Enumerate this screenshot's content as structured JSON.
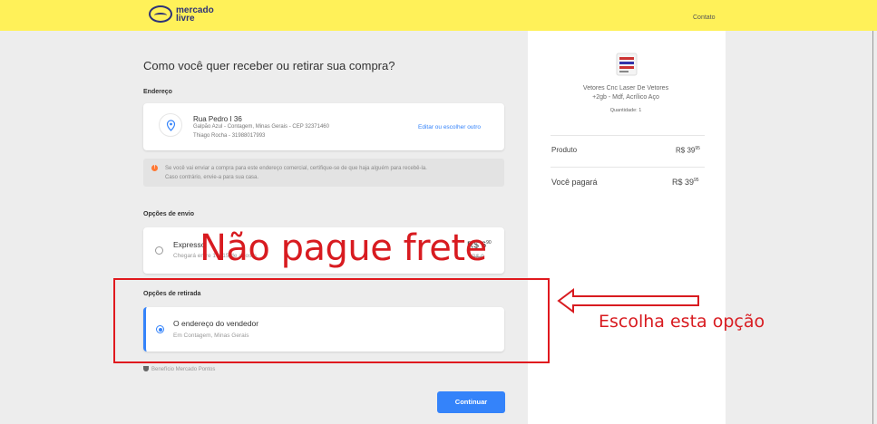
{
  "header": {
    "logo_line1": "mercado",
    "logo_line2": "livre",
    "contact_link": "Contato"
  },
  "main": {
    "title": "Como você quer receber ou retirar sua compra?",
    "address_section_label": "Endereço",
    "address": {
      "street": "Rua Pedro I 36",
      "detail": "Galpão Azul - Contagem, Minas Gerais - CEP 32371460",
      "recipient": "Thiago Rocha - 31988017993",
      "edit_link": "Editar ou escolher outro"
    },
    "warning": {
      "icon": "exclamation-icon",
      "line1": "Se você vai enviar a compra para este endereço comercial, certifique-se de que haja alguém para recebê-la.",
      "line2": "Caso contrário, envie-a para sua casa."
    },
    "shipping_section_label": "Opções de envio",
    "shipping_option": {
      "title": "Expresso",
      "subtitle": "Chegará entre 1 e 15 de agosto",
      "price_prefix": "R$ 6",
      "price_cents": "90",
      "old_price": "R$ 9"
    },
    "pickup_section_label": "Opções de retirada",
    "pickup_option": {
      "title": "O endereço do vendedor",
      "subtitle": "Em Contagem, Minas Gerais",
      "selected": true
    },
    "benefit_text": "Benefício Mercado Pontos",
    "continue_button": "Continuar"
  },
  "summary": {
    "product_name_line1": "Vetores Cnc Laser De Vetores",
    "product_name_line2": "+2gb - Mdf, Acrílico Aço",
    "quantity": "Quantidade: 1",
    "product_label": "Produto",
    "product_price": "R$ 39",
    "product_cents": "95",
    "total_label": "Você pagará",
    "total_price": "R$ 39",
    "total_cents": "95"
  },
  "annotations": {
    "headline": "Não pague frete",
    "callout": "Escolha esta opção",
    "color": "#d81b20"
  },
  "colors": {
    "brand_yellow": "#fff159",
    "accent_blue": "#3483fa"
  }
}
